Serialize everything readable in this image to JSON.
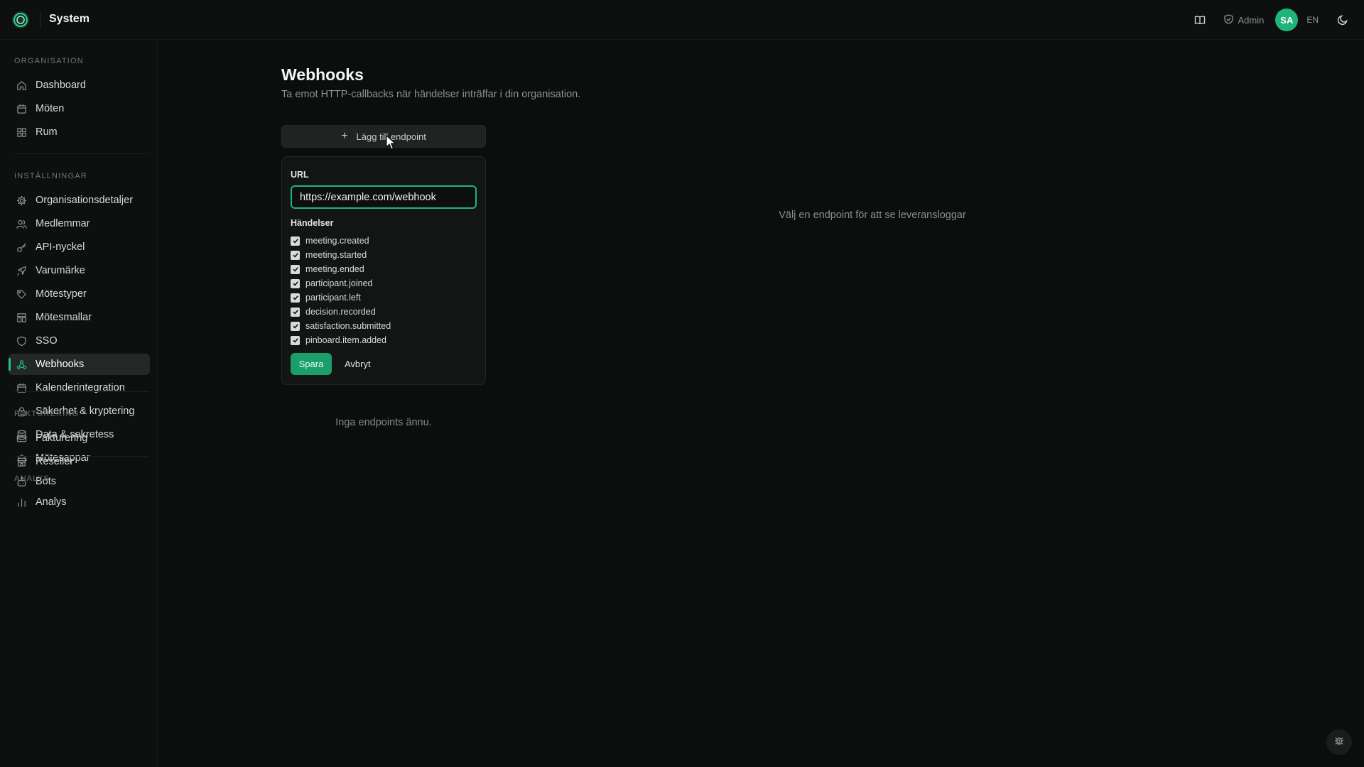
{
  "app": {
    "title": "System"
  },
  "header": {
    "admin_label": "Admin",
    "avatar_initials": "SA",
    "language": "EN",
    "icons": [
      "book-icon",
      "shield-icon",
      "moon-icon"
    ],
    "accent_color": "#1fb57a"
  },
  "sidebar": {
    "sections": [
      {
        "label": "ORGANISATION",
        "items": [
          {
            "label": "Dashboard",
            "icon": "home-icon"
          },
          {
            "label": "Möten",
            "icon": "calendar-icon"
          },
          {
            "label": "Rum",
            "icon": "grid-icon"
          }
        ]
      },
      {
        "label": "INSTÄLLNINGAR",
        "items": [
          {
            "label": "Organisationsdetaljer",
            "icon": "gear-icon"
          },
          {
            "label": "Medlemmar",
            "icon": "users-icon"
          },
          {
            "label": "API-nyckel",
            "icon": "key-icon"
          },
          {
            "label": "Varumärke",
            "icon": "rocket-icon"
          },
          {
            "label": "Mötestyper",
            "icon": "tag-icon"
          },
          {
            "label": "Mötesmallar",
            "icon": "template-icon"
          },
          {
            "label": "SSO",
            "icon": "shield-icon"
          },
          {
            "label": "Webhooks",
            "icon": "webhook-icon",
            "active": true
          },
          {
            "label": "Kalenderintegration",
            "icon": "calendar-icon"
          },
          {
            "label": "Säkerhet & kryptering",
            "icon": "lock-icon"
          },
          {
            "label": "Data & sekretess",
            "icon": "database-icon"
          },
          {
            "label": "Mötesappar",
            "icon": "puzzle-icon"
          },
          {
            "label": "Bots",
            "icon": "bot-icon"
          }
        ]
      },
      {
        "label": "FAKTURERING",
        "items": [
          {
            "label": "Fakturering",
            "icon": "card-icon"
          },
          {
            "label": "Reseller",
            "icon": "store-icon"
          }
        ]
      },
      {
        "label": "ANALYS",
        "items": [
          {
            "label": "Analys",
            "icon": "bar-chart-icon"
          }
        ]
      }
    ]
  },
  "main": {
    "title": "Webhooks",
    "subtitle": "Ta emot HTTP-callbacks när händelser inträffar i din organisation.",
    "add_button": "Lägg till endpoint",
    "form": {
      "url_label": "URL",
      "url_value": "https://example.com/webhook",
      "events_label": "Händelser",
      "events": [
        {
          "name": "meeting.created",
          "checked": true
        },
        {
          "name": "meeting.started",
          "checked": true
        },
        {
          "name": "meeting.ended",
          "checked": true
        },
        {
          "name": "participant.joined",
          "checked": true
        },
        {
          "name": "participant.left",
          "checked": true
        },
        {
          "name": "decision.recorded",
          "checked": true
        },
        {
          "name": "satisfaction.submitted",
          "checked": true
        },
        {
          "name": "pinboard.item.added",
          "checked": true
        }
      ],
      "save_label": "Spara",
      "cancel_label": "Avbryt"
    },
    "empty_message": "Inga endpoints ännu.",
    "detail_placeholder": "Välj en endpoint för att se leveransloggar"
  }
}
